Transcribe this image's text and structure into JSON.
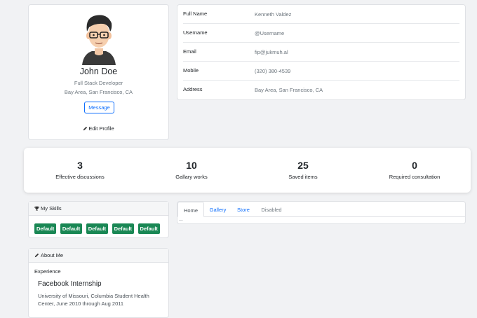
{
  "profile": {
    "name": "John Doe",
    "role": "Full Stack Developer",
    "location": "Bay Area, San Francisco, CA",
    "message_label": "Message",
    "edit_label": "Edit Profile"
  },
  "info": {
    "rows": [
      {
        "label": "Full Name",
        "value": "Kenneth Valdez"
      },
      {
        "label": "Username",
        "value": "@Username"
      },
      {
        "label": "Email",
        "value": "fip@jukmuh.al"
      },
      {
        "label": "Mobile",
        "value": "(320) 380-4539"
      },
      {
        "label": "Address",
        "value": "Bay Area, San Francisco, CA"
      }
    ]
  },
  "stats": [
    {
      "value": "3",
      "label": "Effective discussions"
    },
    {
      "value": "10",
      "label": "Gallary works"
    },
    {
      "value": "25",
      "label": "Saved items"
    },
    {
      "value": "0",
      "label": "Required consultation"
    }
  ],
  "skills": {
    "title": "My Skills",
    "icon": "trophy-icon",
    "items": [
      "Default",
      "Default",
      "Default",
      "Default",
      "Default"
    ],
    "badge_color": "#198754"
  },
  "about": {
    "title": "About Me",
    "icon": "pencil-icon",
    "section": "Experience",
    "job_title": "Facebook Internship",
    "job_desc": "University of Missouri, Columbia Student Health Center, June 2010 through Aug 2011"
  },
  "tabs": {
    "items": [
      "Home",
      "Gallery",
      "Store",
      "Disabled"
    ],
    "active": "Home",
    "content": "..."
  },
  "colors": {
    "accent": "#0d6efd",
    "success": "#198754",
    "muted": "#6c757d"
  }
}
